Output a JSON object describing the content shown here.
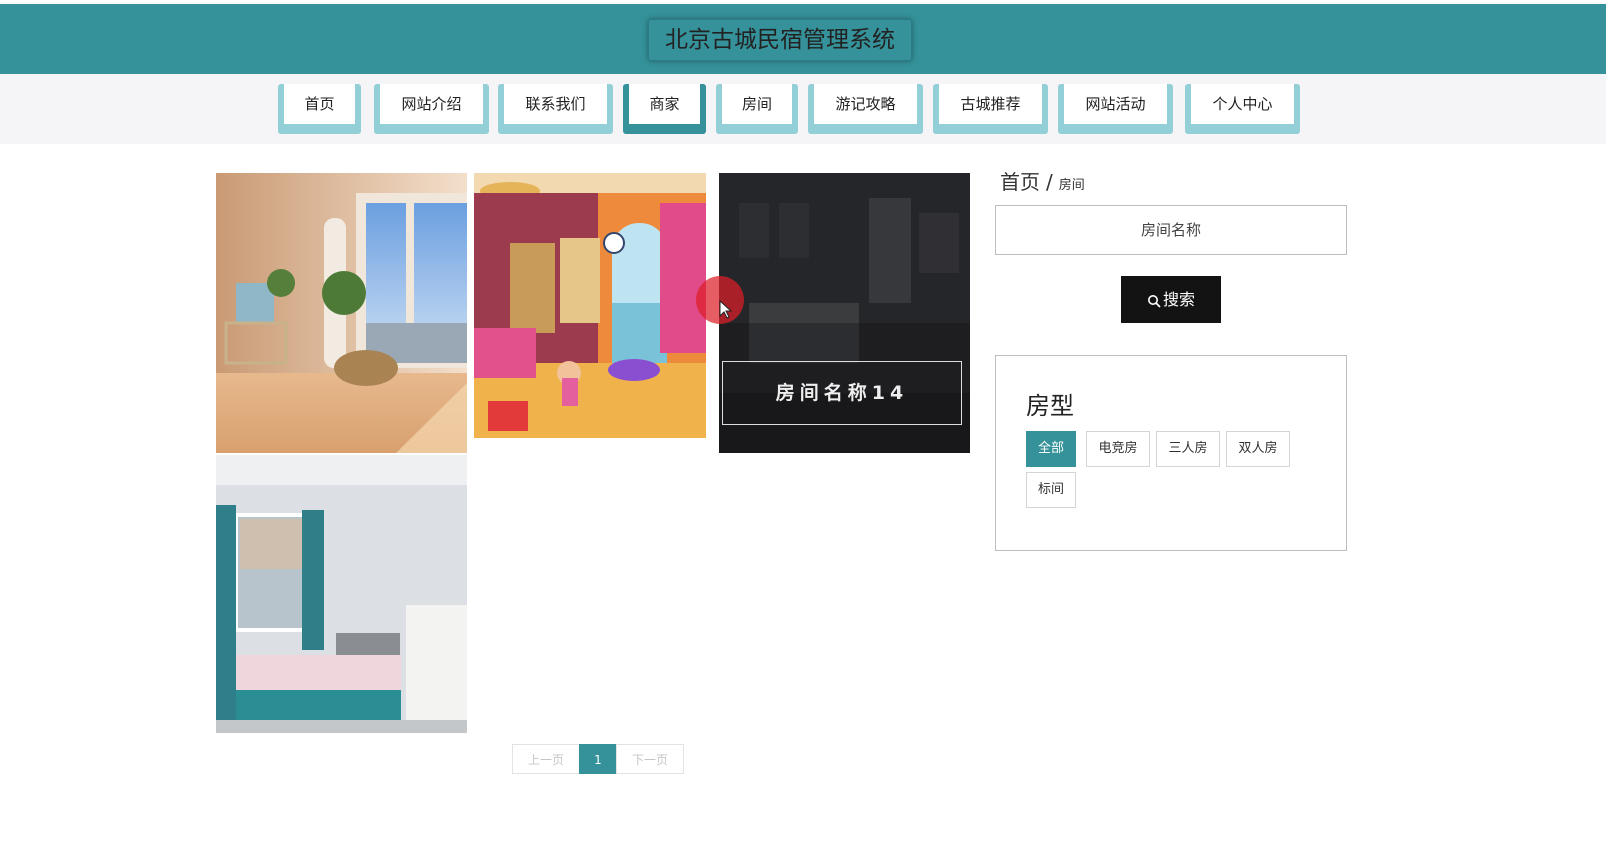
{
  "header": {
    "title": "北京古城民宿管理系统"
  },
  "nav": {
    "items": [
      {
        "label": "首页"
      },
      {
        "label": "网站介绍"
      },
      {
        "label": "联系我们"
      },
      {
        "label": "商家"
      },
      {
        "label": "房间"
      },
      {
        "label": "游记攻略"
      },
      {
        "label": "古城推荐"
      },
      {
        "label": "网站活动"
      },
      {
        "label": "个人中心"
      }
    ],
    "active": "商家"
  },
  "gallery": {
    "hover_caption": "房间名称14"
  },
  "pagination": {
    "prev": "上一页",
    "current": "1",
    "next": "下一页"
  },
  "sidebar": {
    "breadcrumb": {
      "home": "首页",
      "separator": "/",
      "current": "房间"
    },
    "search": {
      "placeholder": "房间名称",
      "button": "搜索"
    },
    "filter": {
      "title": "房型",
      "options": [
        "全部",
        "电竞房",
        "三人房",
        "双人房",
        "标间"
      ],
      "selected": "全部"
    }
  },
  "colors": {
    "primary": "#35919a",
    "nav_tab": "#92cfd6",
    "button_dark": "#131313"
  }
}
